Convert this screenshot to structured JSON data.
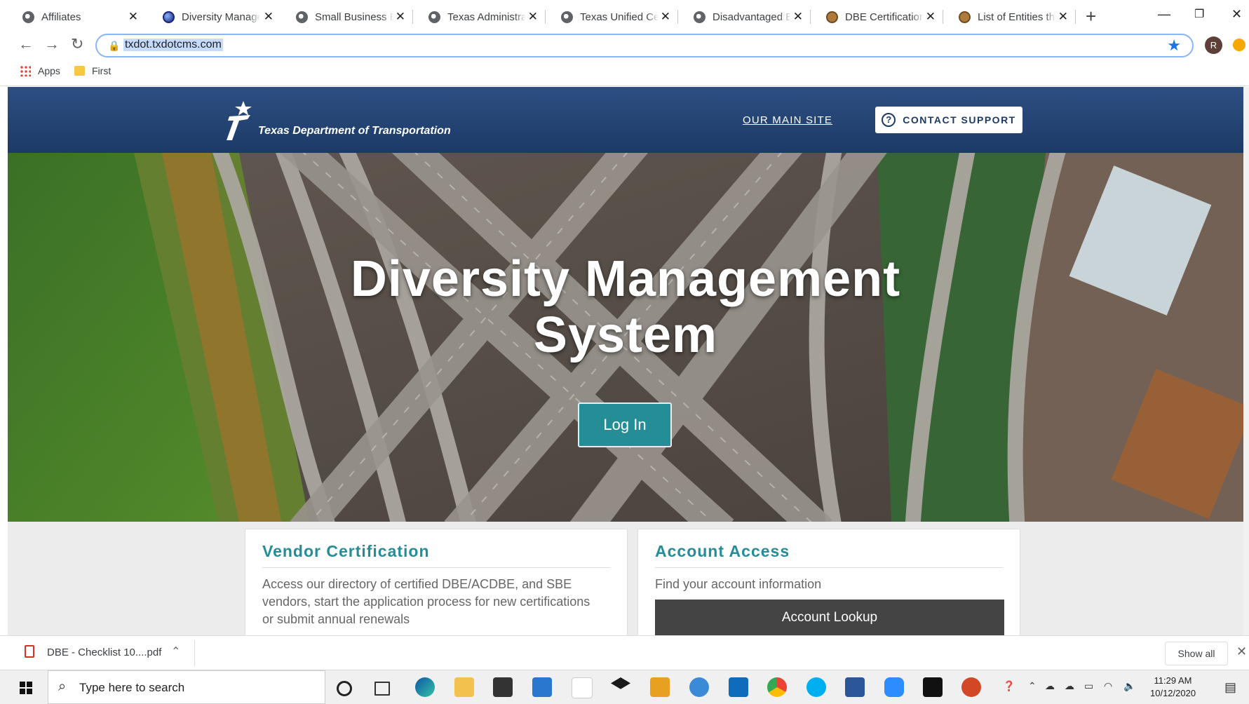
{
  "browser": {
    "tabs": [
      {
        "title": "Affiliates",
        "fav": "globe"
      },
      {
        "title": "Diversity Management System",
        "fav": "blue"
      },
      {
        "title": "Small Business Enterprise",
        "fav": "globe"
      },
      {
        "title": "Texas Administrative Code",
        "fav": "globe"
      },
      {
        "title": "Texas Unified Certification",
        "fav": "globe"
      },
      {
        "title": "Disadvantaged Business",
        "fav": "globe"
      },
      {
        "title": "DBE Certification Application",
        "fav": "seal"
      },
      {
        "title": "List of Entities that",
        "fav": "seal"
      }
    ],
    "new_tab": "+",
    "url": "txdot.txdotcms.com",
    "profile_initial": "R",
    "bookmarks": {
      "apps": "Apps",
      "first": "First"
    }
  },
  "site": {
    "logo_text": "Texas Department of Transportation",
    "nav_main_site": "OUR MAIN SITE",
    "contact_support": "CONTACT SUPPORT",
    "hero_title_line1": "Diversity Management",
    "hero_title_line2": "System",
    "login_label": "Log In",
    "colors": {
      "header": "#1c3a67",
      "accent": "#248d96",
      "button_dark": "#444444"
    }
  },
  "cards": {
    "vendor": {
      "title": "Vendor Certification",
      "body": "Access our directory of certified DBE/ACDBE, and SBE vendors, start the application process for new certifications or submit annual renewals"
    },
    "account": {
      "title": "Account Access",
      "body": "Find your account information",
      "button": "Account Lookup"
    }
  },
  "downloads": {
    "file": "DBE - Checklist 10....pdf",
    "show_all": "Show all"
  },
  "taskbar": {
    "search_placeholder": "Type here to search",
    "time": "11:29 AM",
    "date": "10/12/2020"
  }
}
